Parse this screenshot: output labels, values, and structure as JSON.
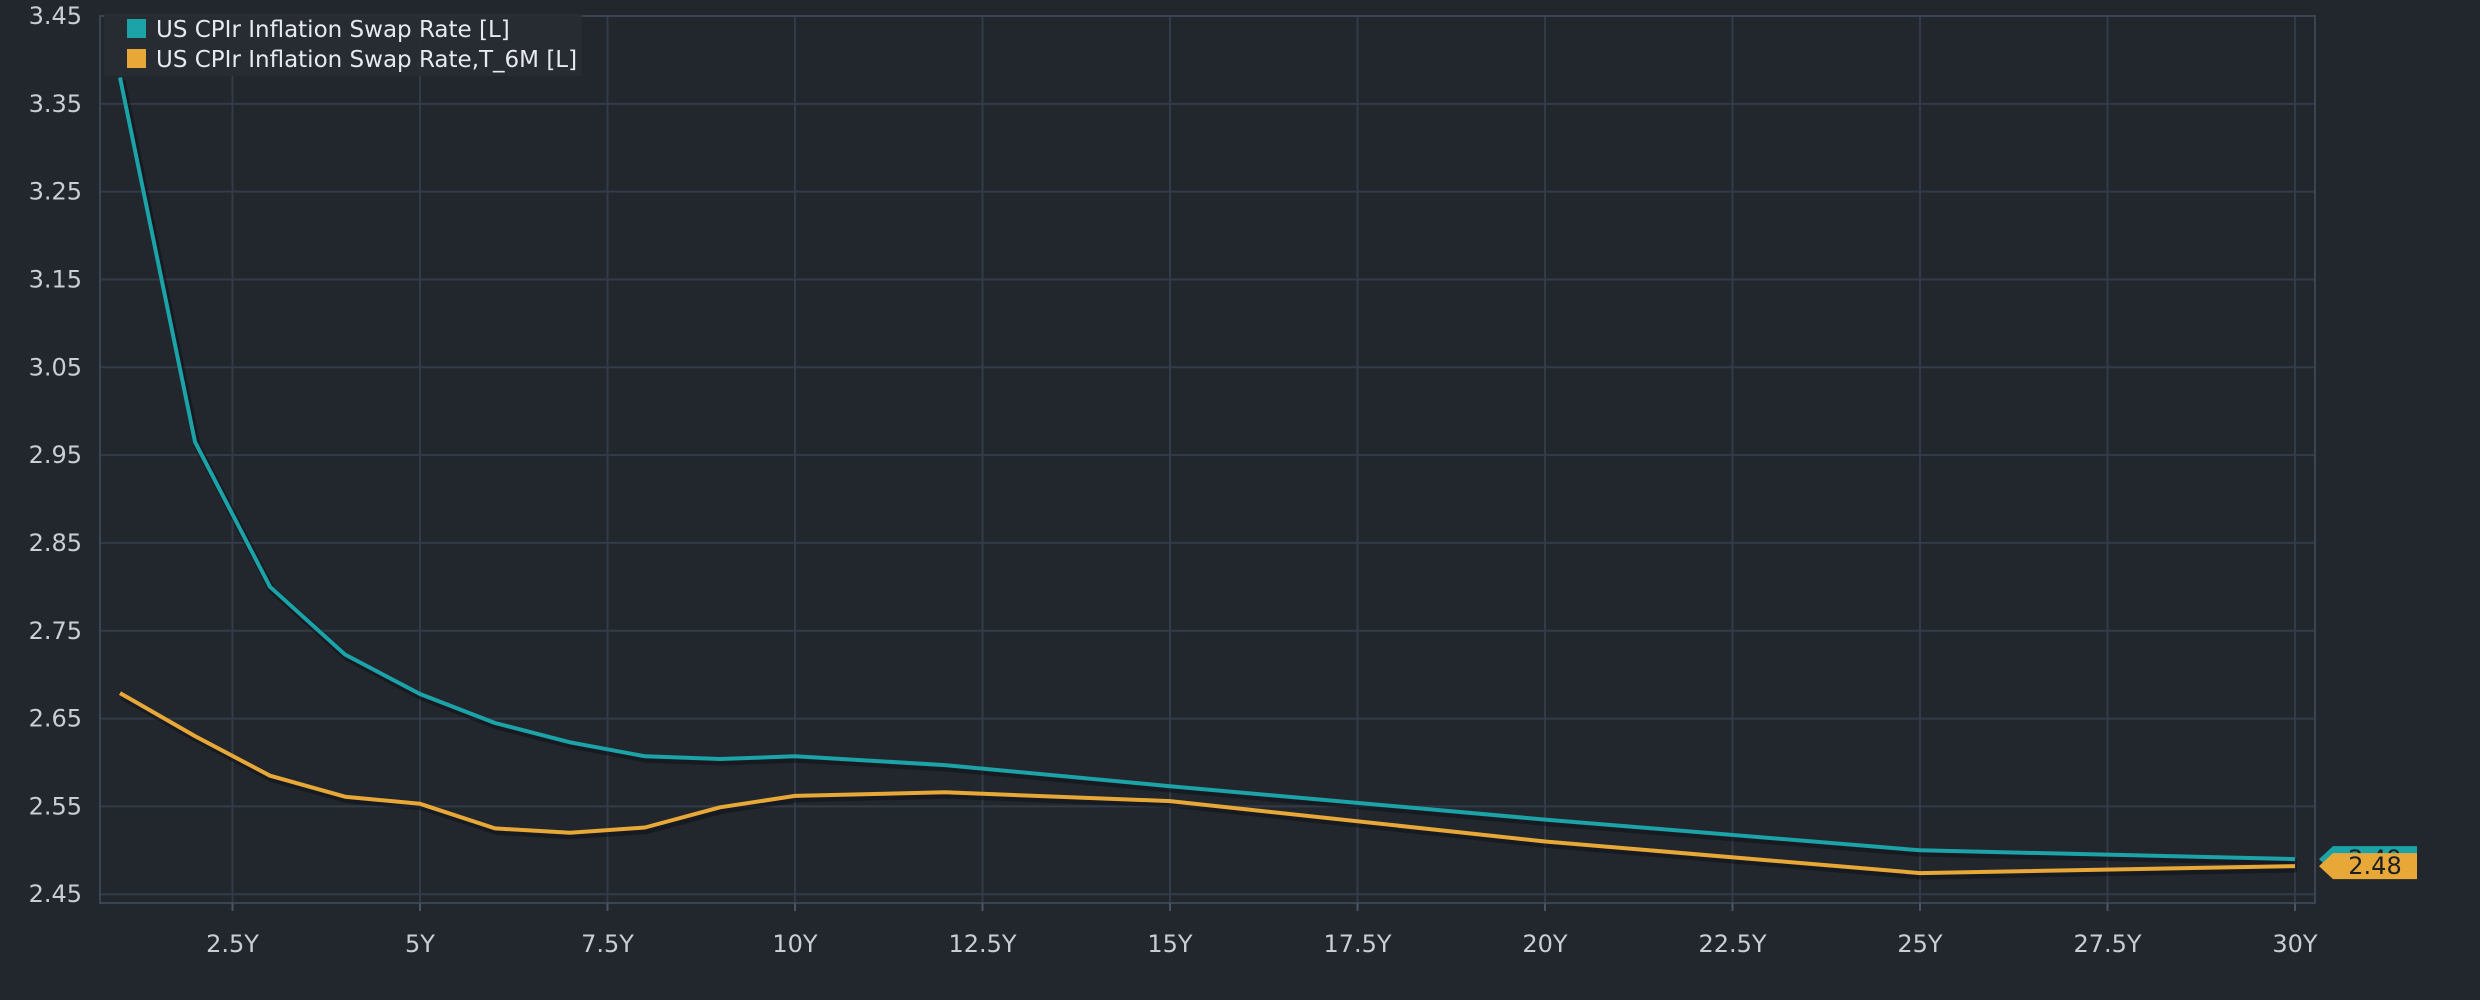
{
  "chart_data": {
    "type": "line",
    "xlabel": "",
    "ylabel": "",
    "xlim": [
      1,
      30
    ],
    "ylim": [
      2.44,
      3.45
    ],
    "y_ticks": [
      "3.45",
      "3.35",
      "3.25",
      "3.15",
      "3.05",
      "2.95",
      "2.85",
      "2.75",
      "2.65",
      "2.55",
      "2.45"
    ],
    "x_ticks": [
      "2.5Y",
      "5Y",
      "7.5Y",
      "10Y",
      "12.5Y",
      "15Y",
      "17.5Y",
      "20Y",
      "22.5Y",
      "25Y",
      "27.5Y",
      "30Y"
    ],
    "grid": true,
    "legend_position": "top-left",
    "series": [
      {
        "name": "US CPIr Inflation Swap Rate [L]",
        "color": "#1ba3a8",
        "x": [
          1,
          2,
          3,
          4,
          5,
          6,
          7,
          8,
          9,
          10,
          12,
          15,
          20,
          25,
          30
        ],
        "y": [
          3.38,
          2.965,
          2.8,
          2.723,
          2.678,
          2.645,
          2.623,
          2.607,
          2.604,
          2.607,
          2.597,
          2.573,
          2.535,
          2.5,
          2.49
        ],
        "end_label": "2.49"
      },
      {
        "name": "US CPIr Inflation Swap Rate,T_6M [L]",
        "color": "#e8a838",
        "x": [
          1,
          2,
          3,
          4,
          5,
          6,
          7,
          8,
          9,
          10,
          12,
          15,
          20,
          25,
          30
        ],
        "y": [
          2.679,
          2.63,
          2.585,
          2.561,
          2.553,
          2.525,
          2.52,
          2.526,
          2.549,
          2.562,
          2.566,
          2.556,
          2.51,
          2.474,
          2.482
        ],
        "end_label": "2.48"
      }
    ]
  }
}
